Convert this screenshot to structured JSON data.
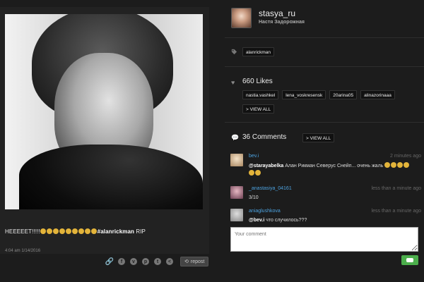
{
  "post": {
    "caption_text": "HEEEEET!!!!!",
    "caption_emoji_count": 9,
    "caption_hashtag": "#alanrickman",
    "caption_tail": " RIP",
    "date": "4:04 am 1/14/2016",
    "repost_label": "repost"
  },
  "author": {
    "username": "stasya_ru",
    "full_name": "Настя Задорожная"
  },
  "tags": [
    "alanrickman"
  ],
  "likes": {
    "label": "660 Likes",
    "users": [
      "nastia.vashkel",
      "lena_voskresensk",
      "20arina05",
      "alinazorinaaa"
    ],
    "view_all": "> VIEW ALL"
  },
  "comments": {
    "label": "36 Comments",
    "view_all": "> VIEW ALL",
    "items": [
      {
        "user": "bev.i",
        "time": "2 minutes ago",
        "mention": "@starayabelka",
        "text": " Алан Рикман Северус Снейп... очень жаль"
      },
      {
        "user": "_anastasiya_04161",
        "time": "less than a minute ago",
        "mention": "",
        "text": "3/10"
      },
      {
        "user": "aniaglushkova",
        "time": "less than a minute ago",
        "mention": "@bev.i",
        "text": " что случилось???"
      }
    ],
    "placeholder": "Your comment"
  },
  "colors": {
    "background": "#1c1c1c",
    "panel": "#222222",
    "username_link": "#4da3e0",
    "send_button": "#4cae4c"
  },
  "icons": [
    "link-icon",
    "facebook-icon",
    "vk-icon",
    "pinterest-icon",
    "tumblr-icon",
    "share-icon",
    "repost-icon",
    "tag-icon",
    "heart-icon",
    "comment-icon",
    "send-icon"
  ]
}
